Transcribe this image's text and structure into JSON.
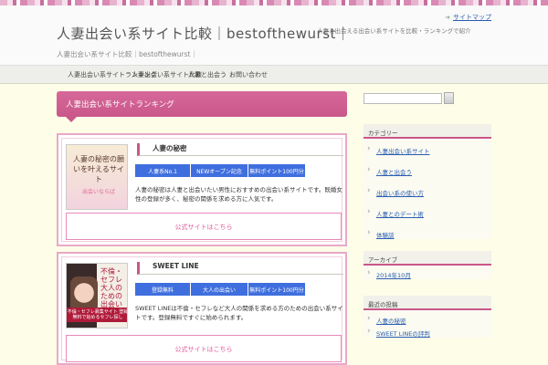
{
  "header": {
    "top_link": "サイトマップ",
    "site_title": "人妻出会い系サイト比較｜bestofthewurst｜",
    "site_subtitle": "人妻出会い系サイト比較｜bestofthewurst｜",
    "description": "人妻と出会える出会い系サイトを比較・ランキングで紹介"
  },
  "nav": [
    "人妻出会い系サイトランキング",
    "人妻出会い系サイト比較",
    "人妻と出会う",
    "お問い合わせ"
  ],
  "main": {
    "heading": "人妻出会い系サイトランキング",
    "cards": [
      {
        "title": "人妻の秘密",
        "thumb_text": "人妻の秘密の願いを叶えるサイト",
        "thumb_sub": "出会いならば",
        "tags": [
          "人妻系No.1",
          "NEWオープン記念",
          "無料ポイント100円分"
        ],
        "desc": "人妻の秘密は人妻と出会いたい男性におすすめの出会い系サイトです。既婚女性の登録が多く、秘密の関係を求める方に人気です。",
        "cta": "公式サイトはこちら"
      },
      {
        "title": "SWEET LINE",
        "thumb_text": "不倫・セフレ大人のための出会いを",
        "thumb_band": "不倫・セフレ募集サイト 登録無料で始めるセフレ探し",
        "tags": [
          "登録無料",
          "大人の出会い",
          "無料ポイント100円分"
        ],
        "desc": "SWEET LINEは不倫・セフレなど大人の関係を求める方のための出会い系サイトです。登録無料ですぐに始められます。",
        "cta": "公式サイトはこちら"
      }
    ]
  },
  "sidebar": {
    "widgets": [
      {
        "title": "カテゴリー",
        "items": [
          "人妻出会い系サイト",
          "人妻と出会う",
          "出会い系の使い方",
          "人妻とのデート術",
          "体験談"
        ]
      },
      {
        "title": "アーカイブ",
        "items": [
          "2014年10月"
        ]
      },
      {
        "title": "最近の投稿",
        "items": [
          "人妻の秘密",
          "SWEET LINEの評判"
        ]
      }
    ]
  },
  "colors": {
    "accent": "#c9578a",
    "tag": "#3f6fde",
    "link": "#2a5db0"
  }
}
